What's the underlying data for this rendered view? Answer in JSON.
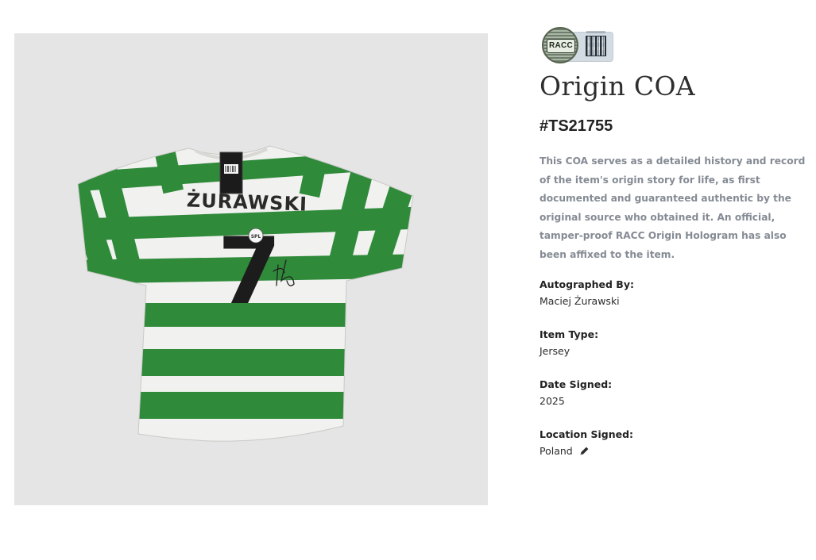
{
  "product_image": {
    "jersey_name": "ŻURAWSKI",
    "jersey_number": "7",
    "sponsor_mark": "SPL"
  },
  "hologram_badge": {
    "text": "RACC"
  },
  "coa": {
    "title": "Origin COA",
    "id": "#TS21755",
    "description": "This COA serves as a detailed history and record of the item's origin story for life, as first documented and guaranteed authentic by the original source who obtained it. An official, tamper-proof RACC Origin Hologram has also been affixed to the item."
  },
  "fields": {
    "autographed_by": {
      "label": "Autographed By:",
      "value": "Maciej Żurawski"
    },
    "item_type": {
      "label": "Item Type:",
      "value": "Jersey"
    },
    "date_signed": {
      "label": "Date Signed:",
      "value": "2025"
    },
    "location_signed": {
      "label": "Location Signed:",
      "value": "Poland"
    }
  },
  "icons": {
    "edit": "pencil-icon"
  },
  "colors": {
    "jersey_green": "#2f8a3a",
    "jersey_white": "#f1f1ef",
    "photo_background": "#e5e5e6",
    "description_text": "#858b94"
  }
}
